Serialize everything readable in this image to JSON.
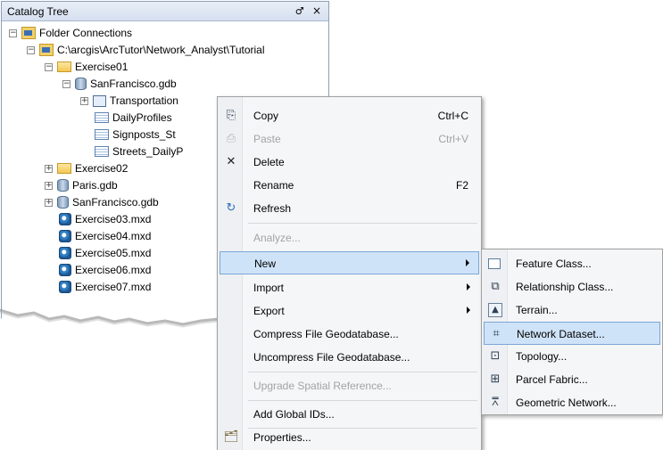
{
  "panel": {
    "title": "Catalog Tree",
    "pin_glyph": "$",
    "close_glyph": "×"
  },
  "tree": {
    "folder_connections": "Folder Connections",
    "path": "C:\\arcgis\\ArcTutor\\Network_Analyst\\Tutorial",
    "exercise01": "Exercise01",
    "sf_gdb": "SanFrancisco.gdb",
    "transportation": "Transportation",
    "daily_profiles": "DailyProfiles",
    "signposts": "Signposts_St",
    "streets": "Streets_DailyP",
    "exercise02": "Exercise02",
    "paris_gdb": "Paris.gdb",
    "sf_gdb2": "SanFrancisco.gdb",
    "mxd": [
      "Exercise03.mxd",
      "Exercise04.mxd",
      "Exercise05.mxd",
      "Exercise06.mxd",
      "Exercise07.mxd"
    ],
    "expand_minus": "−",
    "expand_plus": "+"
  },
  "menu": {
    "copy": "Copy",
    "copy_short": "Ctrl+C",
    "paste": "Paste",
    "paste_short": "Ctrl+V",
    "delete": "Delete",
    "rename": "Rename",
    "rename_short": "F2",
    "refresh": "Refresh",
    "analyze": "Analyze...",
    "new": "New",
    "import": "Import",
    "export": "Export",
    "compress": "Compress File Geodatabase...",
    "uncompress": "Uncompress File Geodatabase...",
    "upgrade": "Upgrade Spatial Reference...",
    "global_ids": "Add Global IDs...",
    "properties": "Properties..."
  },
  "submenu": {
    "feature_class": "Feature Class...",
    "relationship_class": "Relationship Class...",
    "terrain": "Terrain...",
    "network_dataset": "Network Dataset...",
    "topology": "Topology...",
    "parcel_fabric": "Parcel Fabric...",
    "geometric_network": "Geometric Network..."
  },
  "colors": {
    "highlight": "#cfe3f8",
    "highlight_border": "#7aa7d6",
    "disabled": "#a3a3a3"
  }
}
